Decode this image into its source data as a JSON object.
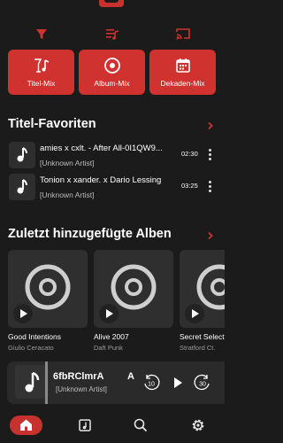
{
  "mix_buttons": [
    {
      "label": "Titel-Mix",
      "icon": "music-mix-icon"
    },
    {
      "label": "Album-Mix",
      "icon": "disc-icon"
    },
    {
      "label": "Dekaden-Mix",
      "icon": "calendar-icon"
    }
  ],
  "favorites": {
    "title": "Titel-Favoriten",
    "tracks": [
      {
        "title": "amies x cxlt. - After All-0I1QW9...",
        "artist": "[Unknown Artist]",
        "duration": "02:30"
      },
      {
        "title": "Tonion x xander. x Dario Lessing",
        "artist": "[Unknown Artist]",
        "duration": "03:25"
      }
    ]
  },
  "recent_albums": {
    "title": "Zuletzt hinzugefügte Alben",
    "albums": [
      {
        "title": "Good Intentions",
        "artist": "Giulio Ceracato"
      },
      {
        "title": "Alive 2007",
        "artist": "Daft Punk"
      },
      {
        "title": "Secret Select",
        "artist": "Stratford Ct."
      }
    ]
  },
  "player": {
    "title": "6fbRClmrA",
    "title_right": "A",
    "artist": "[Unknown Artist]",
    "rewind_label": "10",
    "forward_label": "30"
  },
  "colors": {
    "accent": "#d0322f",
    "background": "#1b1b1b",
    "card": "#2f2f2f"
  },
  "icons": {
    "toolbar": [
      "filter-icon",
      "queue-icon",
      "cast-icon"
    ],
    "nav": [
      "home-icon",
      "library-icon",
      "search-icon",
      "settings-icon"
    ]
  }
}
